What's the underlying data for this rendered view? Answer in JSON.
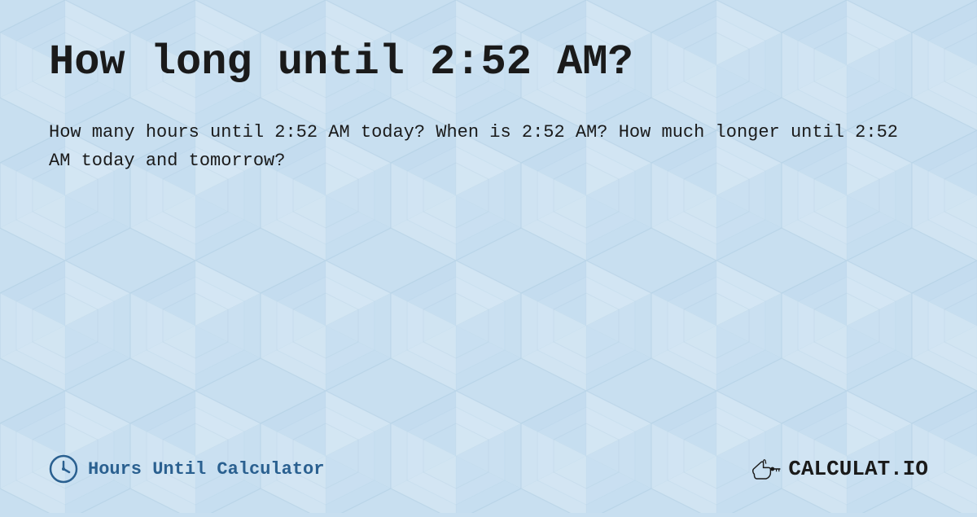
{
  "page": {
    "title": "How long until 2:52 AM?",
    "description": "How many hours until 2:52 AM today? When is 2:52 AM? How much longer until 2:52 AM today and tomorrow?",
    "footer": {
      "site_label": "Hours Until Calculator",
      "logo_text": "CALCULAT.IO"
    },
    "colors": {
      "background": "#c8dff0",
      "title_color": "#1a1a1a",
      "footer_label_color": "#2a6090"
    }
  }
}
